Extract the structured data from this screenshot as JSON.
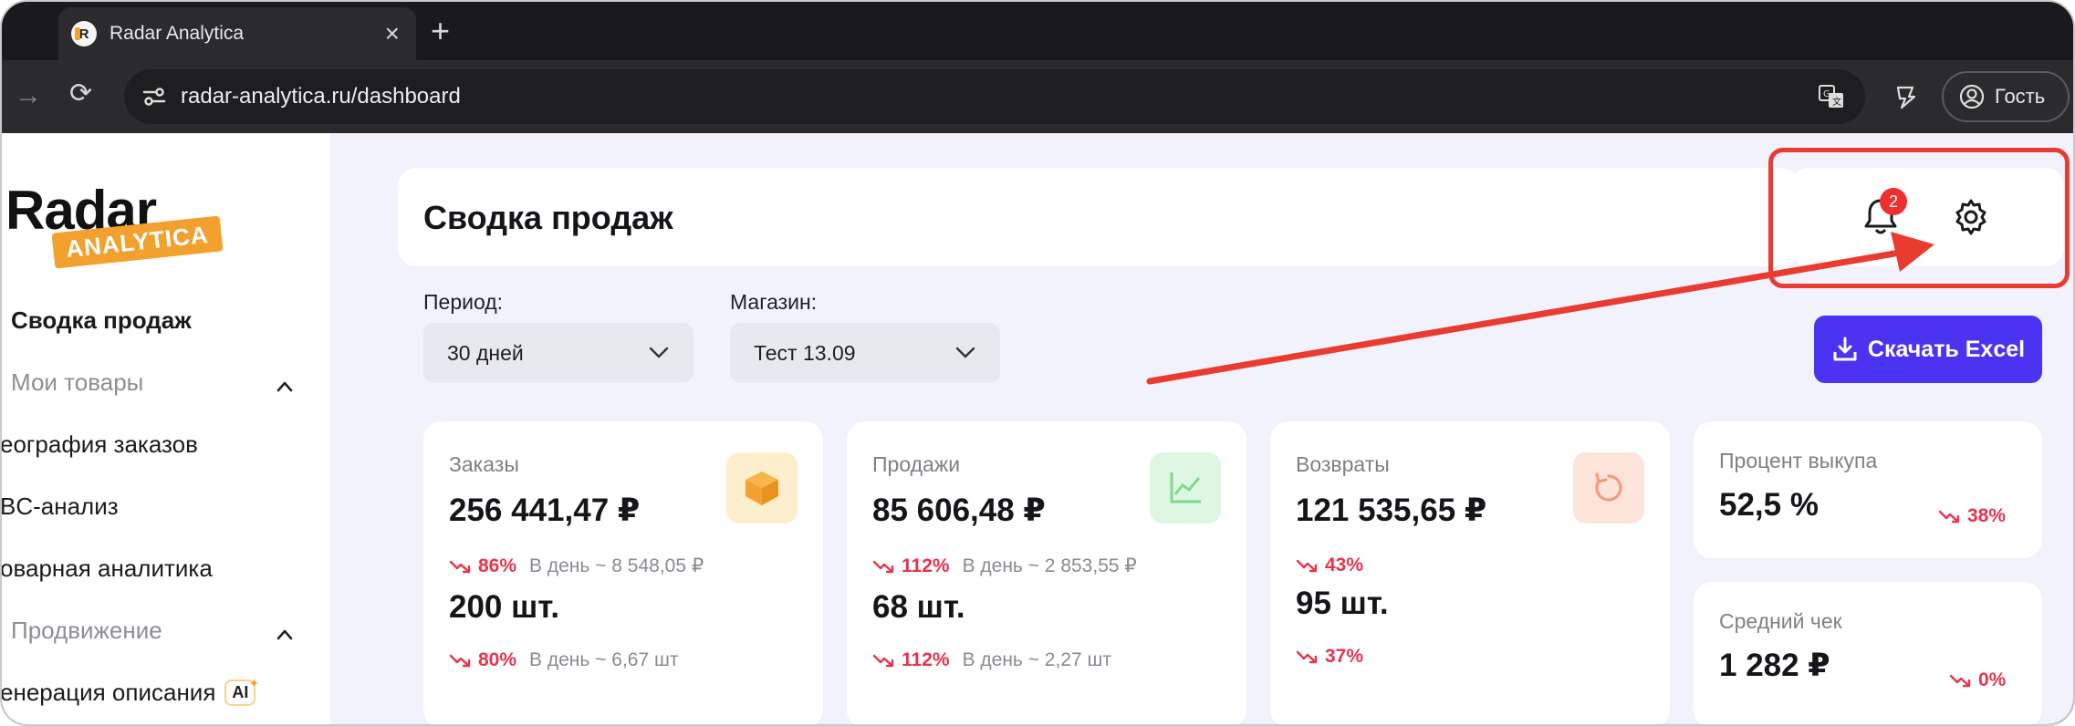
{
  "browser": {
    "tab_title": "Radar Analytica",
    "tab_close": "×",
    "new_tab": "+",
    "url": "radar-analytica.ru/dashboard",
    "profile_label": "Гость"
  },
  "logo": {
    "text": "Radar",
    "badge": "ANALYTICA"
  },
  "sidebar": {
    "items": [
      {
        "label": "Сводка продаж"
      },
      {
        "label": "Мои товары"
      },
      {
        "label": "еография заказов"
      },
      {
        "label": "BC-анализ"
      },
      {
        "label": "оварная аналитика"
      },
      {
        "label": "Продвижение"
      },
      {
        "label": "енерация описания"
      }
    ],
    "ai_badge": "AI"
  },
  "header": {
    "title": "Сводка продаж",
    "notifications_count": "2"
  },
  "filters": {
    "period_label": "Период:",
    "period_value": "30 дней",
    "shop_label": "Магазин:",
    "shop_value": "Тест 13.09"
  },
  "actions": {
    "download_label": "Скачать Excel"
  },
  "cards": {
    "orders": {
      "title": "Заказы",
      "amount": "256 441,47 ₽",
      "amount_pct": "86%",
      "amount_perday": "В день ~ 8 548,05 ₽",
      "count": "200 шт.",
      "count_pct": "80%",
      "count_perday": "В день ~ 6,67 шт"
    },
    "sales": {
      "title": "Продажи",
      "amount": "85 606,48 ₽",
      "amount_pct": "112%",
      "amount_perday": "В день ~ 2 853,55 ₽",
      "count": "68 шт.",
      "count_pct": "112%",
      "count_perday": "В день ~ 2,27 шт"
    },
    "returns": {
      "title": "Возвраты",
      "amount": "121 535,65 ₽",
      "amount_pct": "43%",
      "count": "95 шт.",
      "count_pct": "37%"
    },
    "buyout": {
      "title": "Процент выкупа",
      "value": "52,5 %",
      "pct": "38%"
    },
    "avg_check": {
      "title": "Средний чек",
      "value": "1 282 ₽",
      "pct": "0%"
    }
  },
  "colors": {
    "accent": "#4b33f2",
    "brand": "#f2a12f",
    "negative": "#e7334d",
    "annotation": "#ea3b30",
    "page_bg": "#f1f2fb"
  },
  "icons": [
    "gear-icon",
    "bell-icon",
    "download-icon",
    "box-icon",
    "chart-icon",
    "refresh-icon",
    "trend-down-icon",
    "chevron-down-icon",
    "chevron-up-icon",
    "translate-icon",
    "profile-icon",
    "reload-icon",
    "forward-icon"
  ]
}
